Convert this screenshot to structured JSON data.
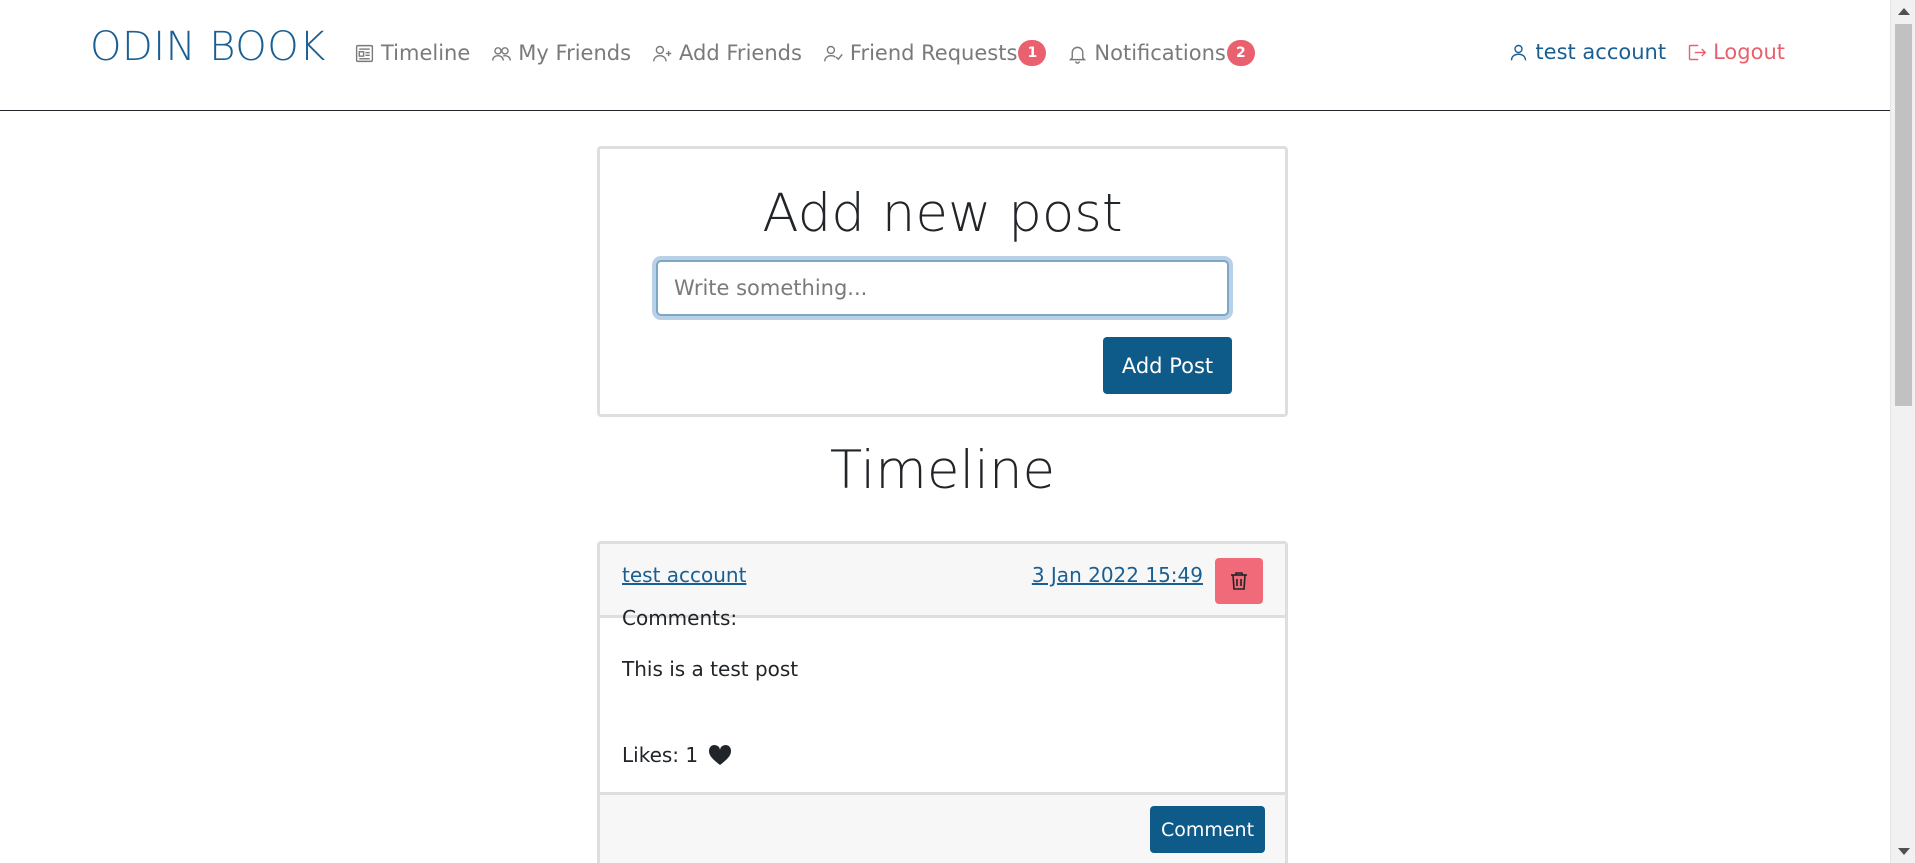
{
  "navbar": {
    "brand": "ODIN BOOK",
    "links": [
      {
        "label": "Timeline",
        "icon": "newspaper-icon"
      },
      {
        "label": "My Friends",
        "icon": "users-icon"
      },
      {
        "label": "Add Friends",
        "icon": "user-plus-icon"
      },
      {
        "label": "Friend Requests",
        "icon": "user-check-icon",
        "badge": "1"
      },
      {
        "label": "Notifications",
        "icon": "bell-icon",
        "badge": "2"
      }
    ],
    "user": "test account",
    "logout": "Logout"
  },
  "add_post": {
    "title": "Add new post",
    "placeholder": "Write something...",
    "value": "",
    "button": "Add Post"
  },
  "timeline": {
    "title": "Timeline",
    "posts": [
      {
        "author": "test account",
        "date": "3 Jan 2022 15:49",
        "body": "This is a test post",
        "likes_label": "Likes: 1",
        "comments_label": "Comments:",
        "comment_button": "Comment"
      }
    ]
  },
  "colors": {
    "brand": "#1a5f93",
    "primary_button": "#0e5b8a",
    "danger": "#e9606e",
    "muted_text": "#7a7a7a"
  }
}
